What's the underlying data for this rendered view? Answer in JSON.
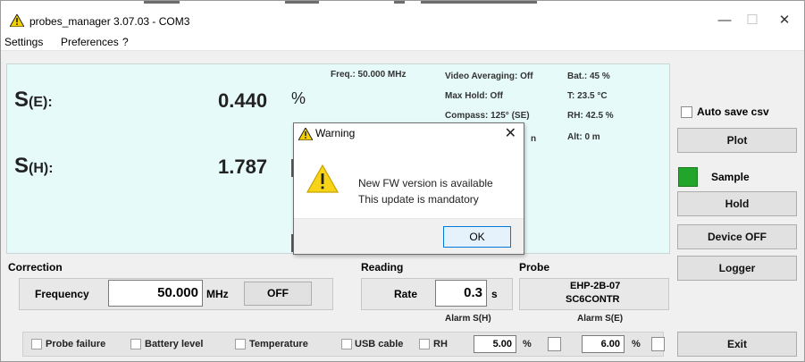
{
  "window": {
    "title": "probes_manager 3.07.03 - COM3",
    "minimize": "—",
    "maximize": "☐",
    "close": "✕"
  },
  "menu": [
    "Settings",
    "Preferences",
    "?"
  ],
  "display": {
    "e_label": "S",
    "e_sub": "(E):",
    "e_value": "0.440",
    "e_unit": "%",
    "h_label": "S",
    "h_sub": "(H):",
    "h_value": "1.787",
    "freq": "Freq.: 50.000 MHz",
    "video_avg": "Video Averaging: Off",
    "max_hold": "Max Hold: Off",
    "compass": "Compass: 125° (SE)",
    "battery": "Bat.:  45 %",
    "temp": "T: 23.5 °C",
    "rh": "RH: 42.5 %",
    "alt": "Alt: 0 m",
    "hidden_frag": "n"
  },
  "right_panel": {
    "auto_save": "Auto save csv",
    "plot": "Plot",
    "sample": "Sample",
    "hold": "Hold",
    "device_off": "Device OFF",
    "logger": "Logger",
    "exit": "Exit"
  },
  "correction": {
    "section": "Correction",
    "freq_label": "Frequency",
    "freq_value": "50.000",
    "freq_unit": "MHz",
    "off": "OFF"
  },
  "reading": {
    "section": "Reading",
    "rate_label": "Rate",
    "rate_value": "0.3",
    "rate_unit": "s"
  },
  "probe": {
    "section": "Probe",
    "model": "EHP-2B-07",
    "serial": "SC6CONTR"
  },
  "alarms": {
    "h_label": "Alarm S(H)",
    "e_label": "Alarm S(E)",
    "h_value": "5.00",
    "e_value": "6.00",
    "unit": "%"
  },
  "bottom": {
    "probe_failure": "Probe failure",
    "battery_level": "Battery level",
    "temperature": "Temperature",
    "usb_cable": "USB cable",
    "rh": "RH"
  },
  "dialog": {
    "title": "Warning",
    "close": "✕",
    "line1": "New FW version is available",
    "line2": "This update is mandatory",
    "ok": "OK"
  },
  "colors": {
    "display_bg": "#e7fafa",
    "led": "#22a52b",
    "warning_yellow": "#f5d000",
    "ok_border": "#0078d7"
  }
}
